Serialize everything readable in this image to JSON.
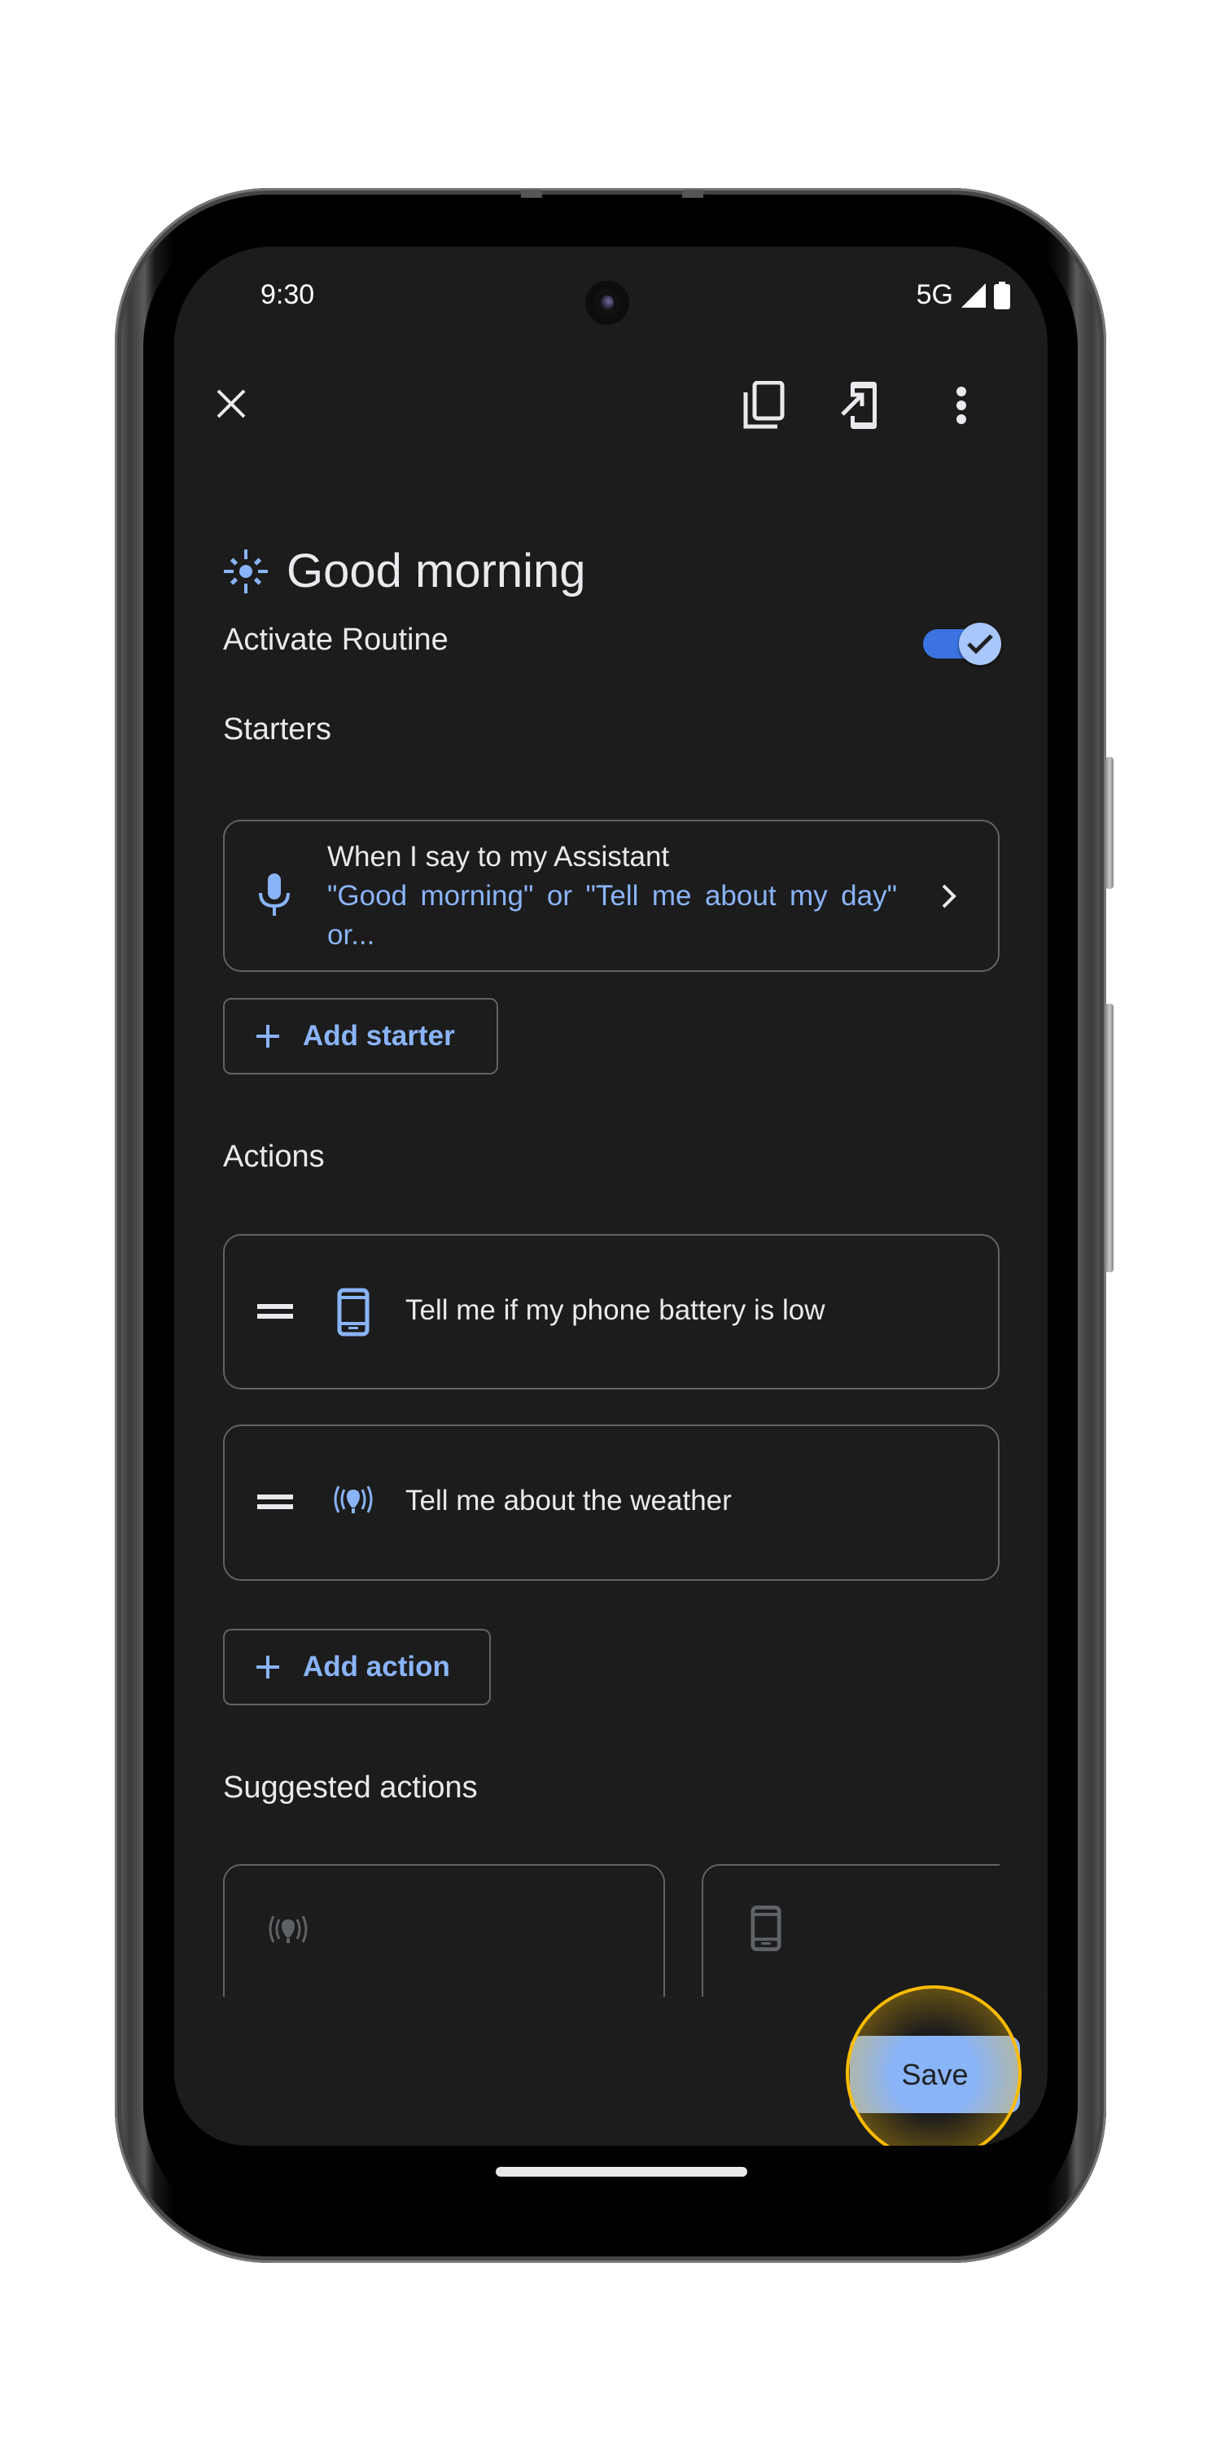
{
  "status_bar": {
    "time": "9:30",
    "network": "5G",
    "signal_icon": "signal-icon",
    "battery_icon": "battery-icon"
  },
  "toolbar": {
    "close_icon": "close-icon",
    "duplicate_icon": "copy-icon",
    "move_icon": "move-to-device-icon",
    "more_icon": "more-vert-icon"
  },
  "routine": {
    "icon": "sun-icon",
    "title": "Good morning",
    "activate_label": "Activate Routine",
    "activate_on": true
  },
  "starters": {
    "heading": "Starters",
    "items": [
      {
        "icon": "mic-icon",
        "title": "When I say to my Assistant",
        "subtitle": "\"Good morning\" or \"Tell me about my day\" or..."
      }
    ],
    "add_label": "Add starter"
  },
  "actions": {
    "heading": "Actions",
    "items": [
      {
        "icon": "phone-icon",
        "label": "Tell me if my phone battery is low"
      },
      {
        "icon": "broadcast-icon",
        "label": "Tell me about the weather"
      }
    ],
    "add_label": "Add action"
  },
  "suggested": {
    "heading": "Suggested actions",
    "items": [
      {
        "icon": "broadcast-icon"
      },
      {
        "icon": "phone-icon"
      }
    ]
  },
  "footer": {
    "save_label": "Save"
  },
  "colors": {
    "accent": "#8ab4f8",
    "toggle_track": "#3b74e0",
    "highlight": "#fbbc04",
    "background": "#1c1c1c"
  }
}
